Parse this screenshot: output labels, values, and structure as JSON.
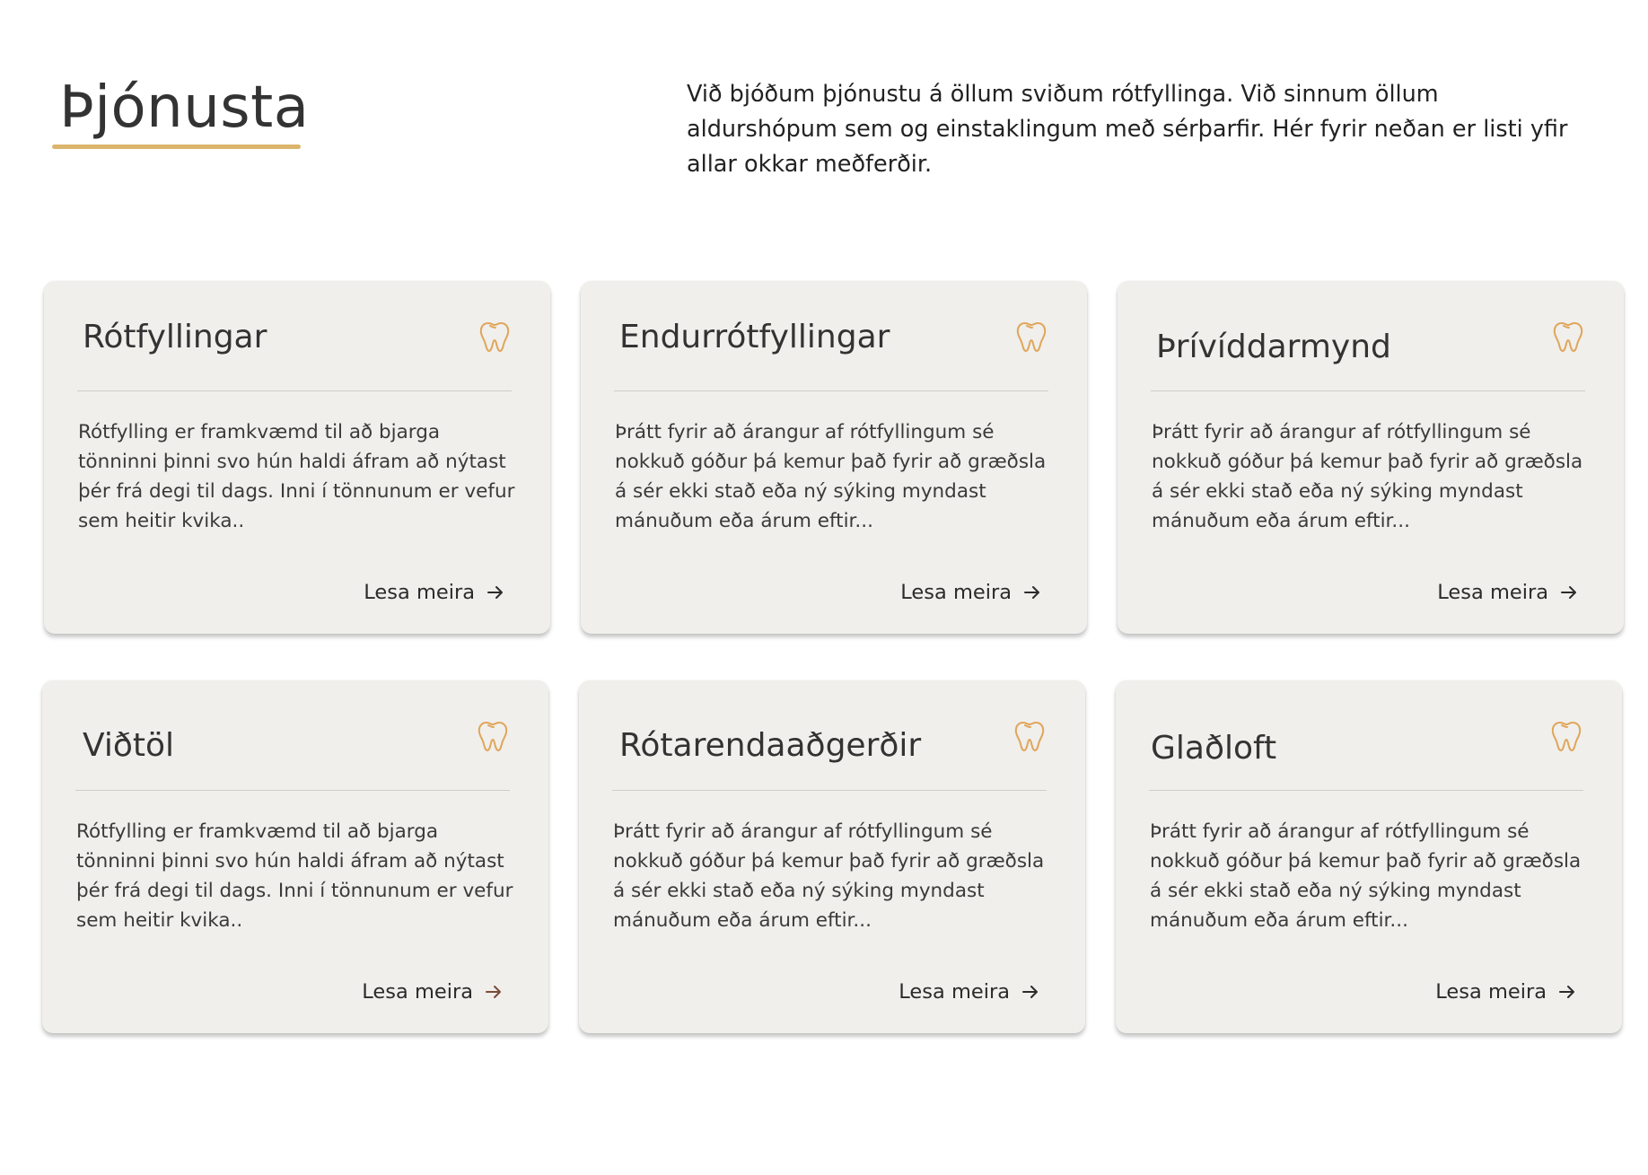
{
  "header": {
    "title": "Þjónusta",
    "intro": "Við bjóðum þjónustu á öllum sviðum rótfyllinga. Við sinnum öllum aldurshópum sem og einstaklingum með sérþarfir. Hér fyrir neðan er listi yfir allar okkar meðferðir."
  },
  "colors": {
    "accent": "#dcb56d",
    "card_background": "#f0efec",
    "icon": "#e0a65a",
    "text": "#333333"
  },
  "cards": [
    {
      "title": "Rótfyllingar",
      "description": "Rótfylling er framkvæmd til að bjarga tönninni þinni svo hún haldi áfram að nýtast þér frá degi til dags. Inni í tönnunum er vefur sem heitir kvika..",
      "link_label": "Lesa meira",
      "icon": "tooth-icon"
    },
    {
      "title": "Endurrótfyllingar",
      "description": "Þrátt fyrir að árangur af rótfyllingum sé nokkuð góður þá kemur það fyrir að græðsla á sér ekki stað eða ný sýking myndast mánuðum eða árum eftir...",
      "link_label": "Lesa meira",
      "icon": "tooth-icon"
    },
    {
      "title": "Þrívíddarmynd",
      "description": "Þrátt fyrir að árangur af rótfyllingum sé nokkuð góður þá kemur það fyrir að græðsla á sér ekki stað eða ný sýking myndast mánuðum eða árum eftir...",
      "link_label": "Lesa meira",
      "icon": "tooth-icon"
    },
    {
      "title": "Viðtöl",
      "description": "Rótfylling er framkvæmd til að bjarga tönninni þinni svo hún haldi áfram að nýtast þér frá degi til dags. Inni í tönnunum er vefur sem heitir kvika..",
      "link_label": "Lesa meira",
      "icon": "tooth-icon"
    },
    {
      "title": "Rótarendaaðgerðir",
      "description": "Þrátt fyrir að árangur af rótfyllingum sé nokkuð góður þá kemur það fyrir að græðsla á sér ekki stað eða ný sýking myndast mánuðum eða árum eftir...",
      "link_label": "Lesa meira",
      "icon": "tooth-icon"
    },
    {
      "title": "Glaðloft",
      "description": "Þrátt fyrir að árangur af rótfyllingum sé nokkuð góður þá kemur það fyrir að græðsla á sér ekki stað eða ný sýking myndast mánuðum eða árum eftir...",
      "link_label": "Lesa meira",
      "icon": "tooth-icon"
    }
  ]
}
